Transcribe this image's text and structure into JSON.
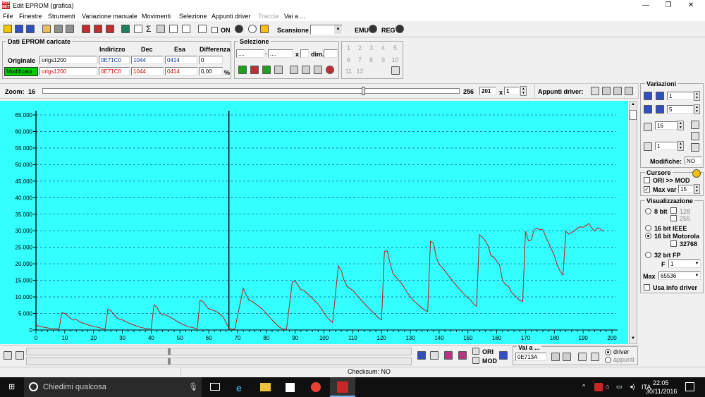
{
  "window": {
    "title": "Edit EPROM (grafica)",
    "logo_text": "ecm BKT",
    "minimize": "—",
    "restore": "❐",
    "close": "✕"
  },
  "menu": [
    "File",
    "Finestre",
    "Strumenti",
    "Variazione manuale",
    "Movimenti",
    "Selezione",
    "Appunti driver",
    "Traccia",
    "Vai a ..."
  ],
  "menu_disabled": [
    false,
    false,
    false,
    false,
    false,
    false,
    false,
    true,
    false
  ],
  "toolbar": {
    "on_label": "ON",
    "scansione_label": "Scansione",
    "scansione_value": "",
    "emu_label": "EMU",
    "reg_label": "REG"
  },
  "dati": {
    "title": "Dati EPROM caricate",
    "headers": [
      "Indirizzo",
      "Dec",
      "Esa",
      "Differenza"
    ],
    "rows": [
      {
        "label": "Originale",
        "name": "origs1200",
        "indirizzo": "0E71C0",
        "dec": "1044",
        "esa": "0414",
        "diff": "0"
      },
      {
        "label": "Modificato",
        "name": "origs1200",
        "indirizzo": "0E71C0",
        "dec": "1044",
        "esa": "0414",
        "diff": "0,00"
      }
    ],
    "pct": "%"
  },
  "selezione": {
    "title": "Selezione",
    "from": "....",
    "to": "....",
    "x_label": "x",
    "dim_label": "dim."
  },
  "numpad": [
    "1",
    "2",
    "3",
    "4",
    "5",
    "6",
    "7",
    "8",
    "9",
    "10",
    "11",
    "12"
  ],
  "zoom": {
    "label": "Zoom:",
    "min": "16",
    "max": "256",
    "value": "201",
    "x_label": "x",
    "mult": "1",
    "appunti_label": "Appunti driver:"
  },
  "variazioni": {
    "title": "Variazioni",
    "v1": "1",
    "v2": "5",
    "v3": "16",
    "v4": "1",
    "modifiche_label": "Modifiche:",
    "modifiche_value": "NO"
  },
  "cursore": {
    "title": "Cursore",
    "ori_mod": "ORI >> MOD",
    "max_var_label": "Max var",
    "max_var_value": "15",
    "ori_mod_checked": false,
    "max_var_checked": true
  },
  "visualizzazione": {
    "title": "Visualizzazione",
    "opt8": "8 bit",
    "o128": "128",
    "o255": "255",
    "opt16ieee": "16 bit IEEE",
    "opt16mot": "16 bit Motorola",
    "o32768": "32768",
    "opt32": "32 bit FP",
    "f_label": "F",
    "f_value": "1",
    "max_label": "Max",
    "max_value": "65536",
    "usa_info": "Usa info driver"
  },
  "bottom": {
    "ori": "ORI",
    "mod": "MOD",
    "vai_label": "Vai a ...",
    "vai_value": "0E713A",
    "driver": "driver",
    "appunti": "appunti"
  },
  "status": {
    "checksum": "Checksum: NO"
  },
  "taskbar": {
    "search_placeholder": "Chiedimi qualcosa",
    "time": "22:05",
    "date": "30/11/2016",
    "lang": "ITA"
  },
  "colors": {
    "plot_bg": "#33ffff",
    "series": "#c01818",
    "grid": "#1a6ea0",
    "active": "#00cc00"
  },
  "chart_data": {
    "type": "line",
    "xlim": [
      0,
      200
    ],
    "ylim": [
      0,
      65000
    ],
    "xticks": [
      "0",
      "10",
      "20",
      "30",
      "40",
      "50",
      "60",
      "70",
      "80",
      "90",
      "100",
      "110",
      "120",
      "130",
      "140",
      "150",
      "160",
      "170",
      "180",
      "190",
      "200"
    ],
    "yticks": [
      "0",
      "5.000",
      "10.000",
      "15.000",
      "20.000",
      "25.000",
      "30.000",
      "35.000",
      "40.000",
      "45.000",
      "50.000",
      "55.000",
      "60.000",
      "65.000"
    ],
    "cursor_x": [
      0,
      67
    ],
    "series": [
      {
        "values": [
          [
            0,
            1500
          ],
          [
            1,
            1200
          ],
          [
            3,
            800
          ],
          [
            5,
            500
          ],
          [
            8,
            300
          ],
          [
            9,
            5200
          ],
          [
            10,
            5000
          ],
          [
            11,
            4300
          ],
          [
            12,
            3500
          ],
          [
            13,
            3000
          ],
          [
            14,
            3200
          ],
          [
            15,
            2600
          ],
          [
            17,
            1900
          ],
          [
            19,
            1300
          ],
          [
            21,
            900
          ],
          [
            23,
            500
          ],
          [
            24,
            300
          ],
          [
            25,
            6300
          ],
          [
            26,
            5800
          ],
          [
            27,
            4800
          ],
          [
            28,
            3700
          ],
          [
            29,
            3300
          ],
          [
            30,
            3100
          ],
          [
            32,
            2200
          ],
          [
            34,
            1500
          ],
          [
            36,
            900
          ],
          [
            38,
            500
          ],
          [
            40,
            300
          ],
          [
            41,
            7700
          ],
          [
            42,
            6900
          ],
          [
            43,
            5300
          ],
          [
            44,
            4500
          ],
          [
            45,
            4600
          ],
          [
            47,
            3700
          ],
          [
            49,
            2600
          ],
          [
            51,
            1700
          ],
          [
            53,
            1000
          ],
          [
            55,
            600
          ],
          [
            56,
            300
          ],
          [
            57,
            9000
          ],
          [
            58,
            8600
          ],
          [
            59,
            7400
          ],
          [
            60,
            6400
          ],
          [
            61,
            6200
          ],
          [
            63,
            5400
          ],
          [
            65,
            4000
          ],
          [
            67,
            500
          ],
          [
            68,
            300
          ],
          [
            69,
            200
          ],
          [
            72,
            12600
          ],
          [
            73,
            10600
          ],
          [
            74,
            9000
          ],
          [
            75,
            8700
          ],
          [
            78,
            6800
          ],
          [
            80,
            5000
          ],
          [
            82,
            3000
          ],
          [
            84,
            1300
          ],
          [
            85,
            600
          ],
          [
            86,
            200
          ],
          [
            87,
            300
          ],
          [
            89,
            14600
          ],
          [
            90,
            14800
          ],
          [
            91,
            13500
          ],
          [
            92,
            12200
          ],
          [
            93,
            12000
          ],
          [
            94,
            11200
          ],
          [
            96,
            9500
          ],
          [
            98,
            7800
          ],
          [
            99,
            6600
          ],
          [
            100,
            5200
          ],
          [
            101,
            4000
          ],
          [
            102,
            3000
          ],
          [
            103,
            2300
          ],
          [
            105,
            19400
          ],
          [
            106,
            18000
          ],
          [
            107,
            15000
          ],
          [
            108,
            13200
          ],
          [
            109,
            12600
          ],
          [
            110,
            12000
          ],
          [
            112,
            10000
          ],
          [
            114,
            8000
          ],
          [
            116,
            6200
          ],
          [
            118,
            4500
          ],
          [
            119,
            3600
          ],
          [
            120,
            3100
          ],
          [
            121,
            23800
          ],
          [
            122,
            23800
          ],
          [
            123,
            20000
          ],
          [
            124,
            17000
          ],
          [
            125,
            16000
          ],
          [
            127,
            14000
          ],
          [
            129,
            11200
          ],
          [
            131,
            9000
          ],
          [
            133,
            7400
          ],
          [
            135,
            6000
          ],
          [
            136,
            5500
          ],
          [
            137,
            26800
          ],
          [
            138,
            26400
          ],
          [
            139,
            22000
          ],
          [
            140,
            19800
          ],
          [
            141,
            19000
          ],
          [
            143,
            16700
          ],
          [
            145,
            14500
          ],
          [
            147,
            12400
          ],
          [
            149,
            10500
          ],
          [
            151,
            9000
          ],
          [
            152,
            7800
          ],
          [
            153,
            7200
          ],
          [
            154,
            28800
          ],
          [
            155,
            28000
          ],
          [
            156,
            27000
          ],
          [
            157,
            25500
          ],
          [
            158,
            22500
          ],
          [
            159,
            22000
          ],
          [
            161,
            19600
          ],
          [
            162,
            15000
          ],
          [
            163,
            13700
          ],
          [
            164,
            13400
          ],
          [
            165,
            11600
          ],
          [
            167,
            9800
          ],
          [
            168,
            9000
          ],
          [
            169,
            8600
          ],
          [
            170,
            29800
          ],
          [
            171,
            27000
          ],
          [
            172,
            27200
          ],
          [
            173,
            30500
          ],
          [
            174,
            30600
          ],
          [
            175,
            30400
          ],
          [
            176,
            30300
          ],
          [
            178,
            26300
          ],
          [
            180,
            22500
          ],
          [
            181,
            19600
          ],
          [
            182,
            17800
          ],
          [
            183,
            16600
          ],
          [
            184,
            29800
          ],
          [
            185,
            29000
          ],
          [
            186,
            29500
          ],
          [
            187,
            30000
          ],
          [
            188,
            30800
          ],
          [
            189,
            31200
          ],
          [
            190,
            31000
          ],
          [
            191,
            31600
          ],
          [
            192,
            32200
          ],
          [
            193,
            30800
          ],
          [
            194,
            29900
          ],
          [
            195,
            30900
          ],
          [
            196,
            30500
          ],
          [
            197,
            29800
          ]
        ]
      }
    ]
  }
}
